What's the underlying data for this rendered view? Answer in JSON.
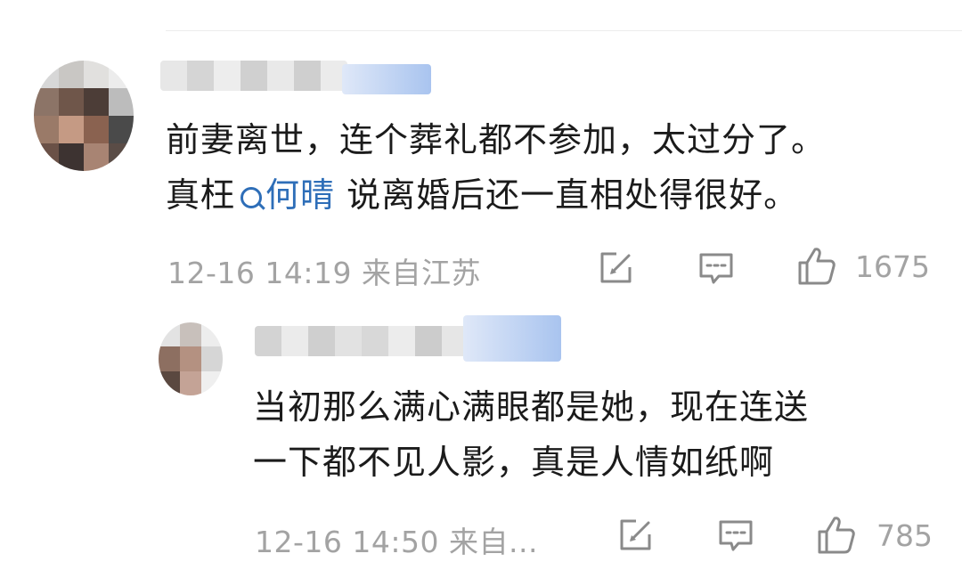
{
  "comments": [
    {
      "text_line1": "前妻离世，连个葬礼都不参加，太过分了。",
      "text_prefix": "真枉",
      "topic": "何晴",
      "text_suffix": " 说离婚后还一直相处得很好。",
      "timestamp": "12-16 14:19",
      "location": "来自江苏",
      "like_count": "1675"
    },
    {
      "text_line1": "当初那么满心满眼都是她，现在连送",
      "text_line2": "一下都不见人影，真是人情如纸啊",
      "timestamp": "12-16 14:50",
      "location": "来自...",
      "like_count": "785"
    }
  ],
  "icons": {
    "topic": "search-topic-icon",
    "share": "share-icon",
    "reply": "comment-icon",
    "like": "thumbs-up-icon"
  },
  "colors": {
    "link": "#2e6eb8",
    "meta": "#a3a3a3",
    "text": "#1b1b1b"
  }
}
